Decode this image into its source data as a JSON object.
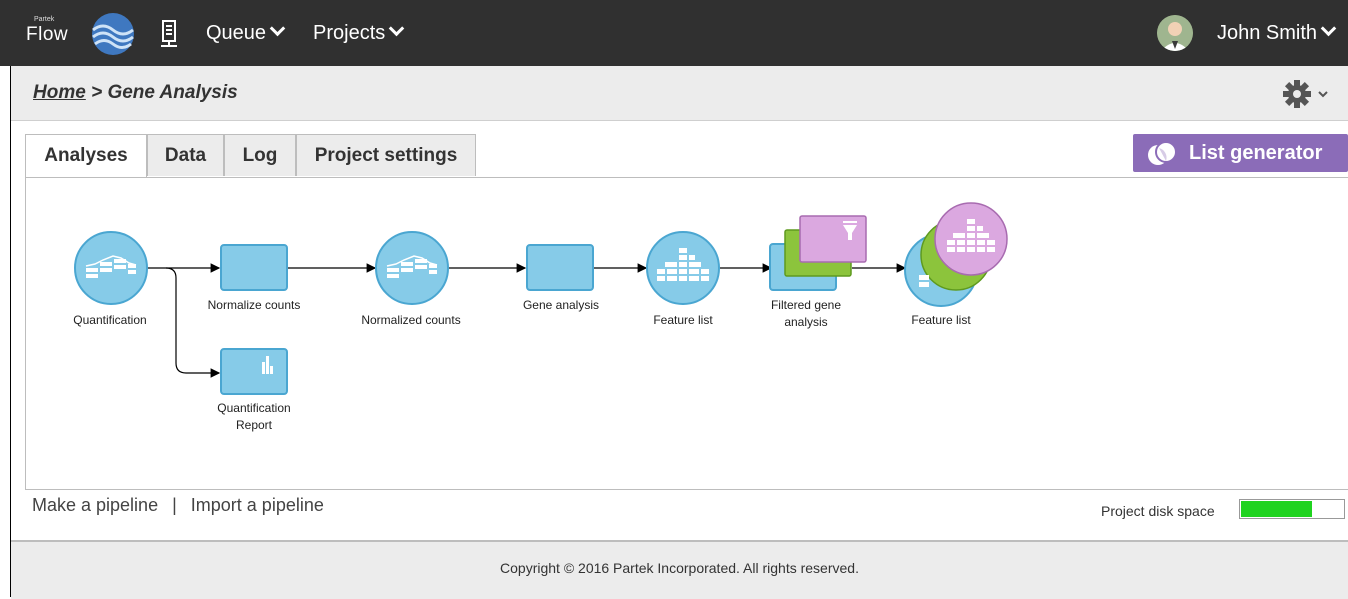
{
  "header": {
    "brand_small": "Partek",
    "brand_name": "Flow",
    "menus": [
      {
        "label": "Queue"
      },
      {
        "label": "Projects"
      }
    ],
    "user_name": "John Smith"
  },
  "breadcrumb": {
    "home": "Home",
    "separator": " > ",
    "current": "Gene Analysis"
  },
  "tabs": [
    {
      "label": "Analyses",
      "active": true
    },
    {
      "label": "Data",
      "active": false
    },
    {
      "label": "Log",
      "active": false
    },
    {
      "label": "Project settings",
      "active": false
    }
  ],
  "list_generator_label": "List generator",
  "pipeline": {
    "nodes": [
      {
        "label": "Quantification",
        "kind": "data-circle"
      },
      {
        "label": "Normalize counts",
        "kind": "task-box"
      },
      {
        "label": "Normalized counts",
        "kind": "data-circle"
      },
      {
        "label": "Gene analysis",
        "kind": "task-box"
      },
      {
        "label": "Feature list",
        "kind": "data-circle"
      },
      {
        "label_line1": "Filtered gene",
        "label_line2": "analysis",
        "kind": "task-box-stack"
      },
      {
        "label": "Feature list",
        "kind": "data-circle-stack"
      },
      {
        "label_line1": "Quantification",
        "label_line2": "Report",
        "kind": "report-box"
      }
    ]
  },
  "bottom_links": {
    "make": "Make a pipeline",
    "separator": "|",
    "import": "Import a pipeline"
  },
  "disk_space": {
    "label": "Project disk space",
    "fraction_used": 0.7
  },
  "footer": {
    "copyright": "Copyright © 2016 Partek Incorporated. All rights reserved."
  },
  "colors": {
    "topbar": "#303030",
    "node_blue": "#86cbe8",
    "node_border": "#4aa6d1",
    "node_green": "#8cc43c",
    "node_pink": "#dba8e0",
    "list_generator": "#8b6cb8",
    "disk_fill": "#1fd31f"
  }
}
